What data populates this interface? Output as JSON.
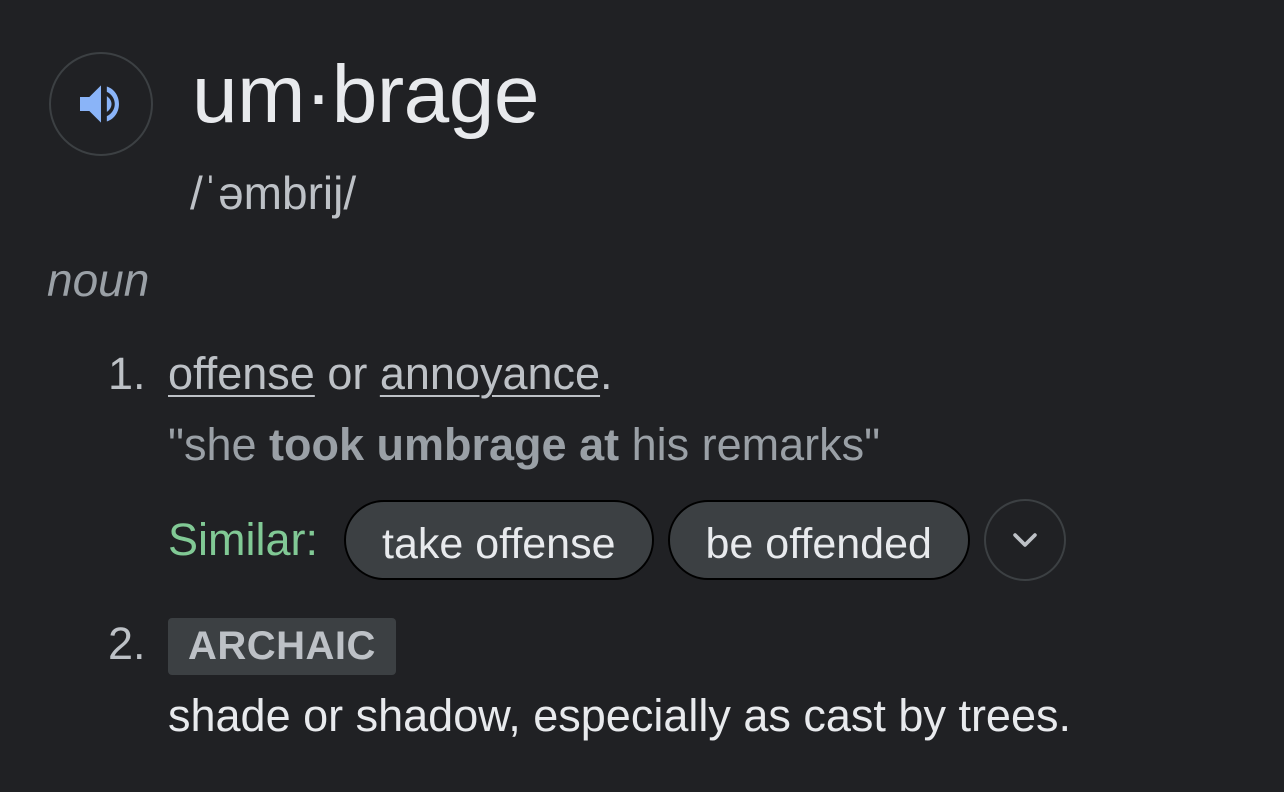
{
  "colors": {
    "background": "#202124",
    "accent_blue": "#8ab4f8",
    "similar_green": "#81c995",
    "chip_bg": "#3c4043",
    "text_primary": "#e8eaed",
    "text_secondary": "#bdc1c6"
  },
  "entry": {
    "audio_icon": "speaker-icon",
    "headword": "um·brage",
    "phonetic": "/ˈəmbrij/",
    "part_of_speech": "noun"
  },
  "senses": [
    {
      "number": "1.",
      "def_link_1": "offense",
      "def_connector": " or ",
      "def_link_2": "annoyance",
      "def_end": ".",
      "example_open": "\"she ",
      "example_bold": "took umbrage at",
      "example_close": " his remarks\"",
      "similar_label": "Similar:",
      "similar_chips": [
        "take offense",
        "be offended"
      ],
      "expand_icon": "chevron-down-icon"
    },
    {
      "number": "2.",
      "label": "ARCHAIC",
      "definition": "shade or shadow, especially as cast by trees."
    }
  ]
}
